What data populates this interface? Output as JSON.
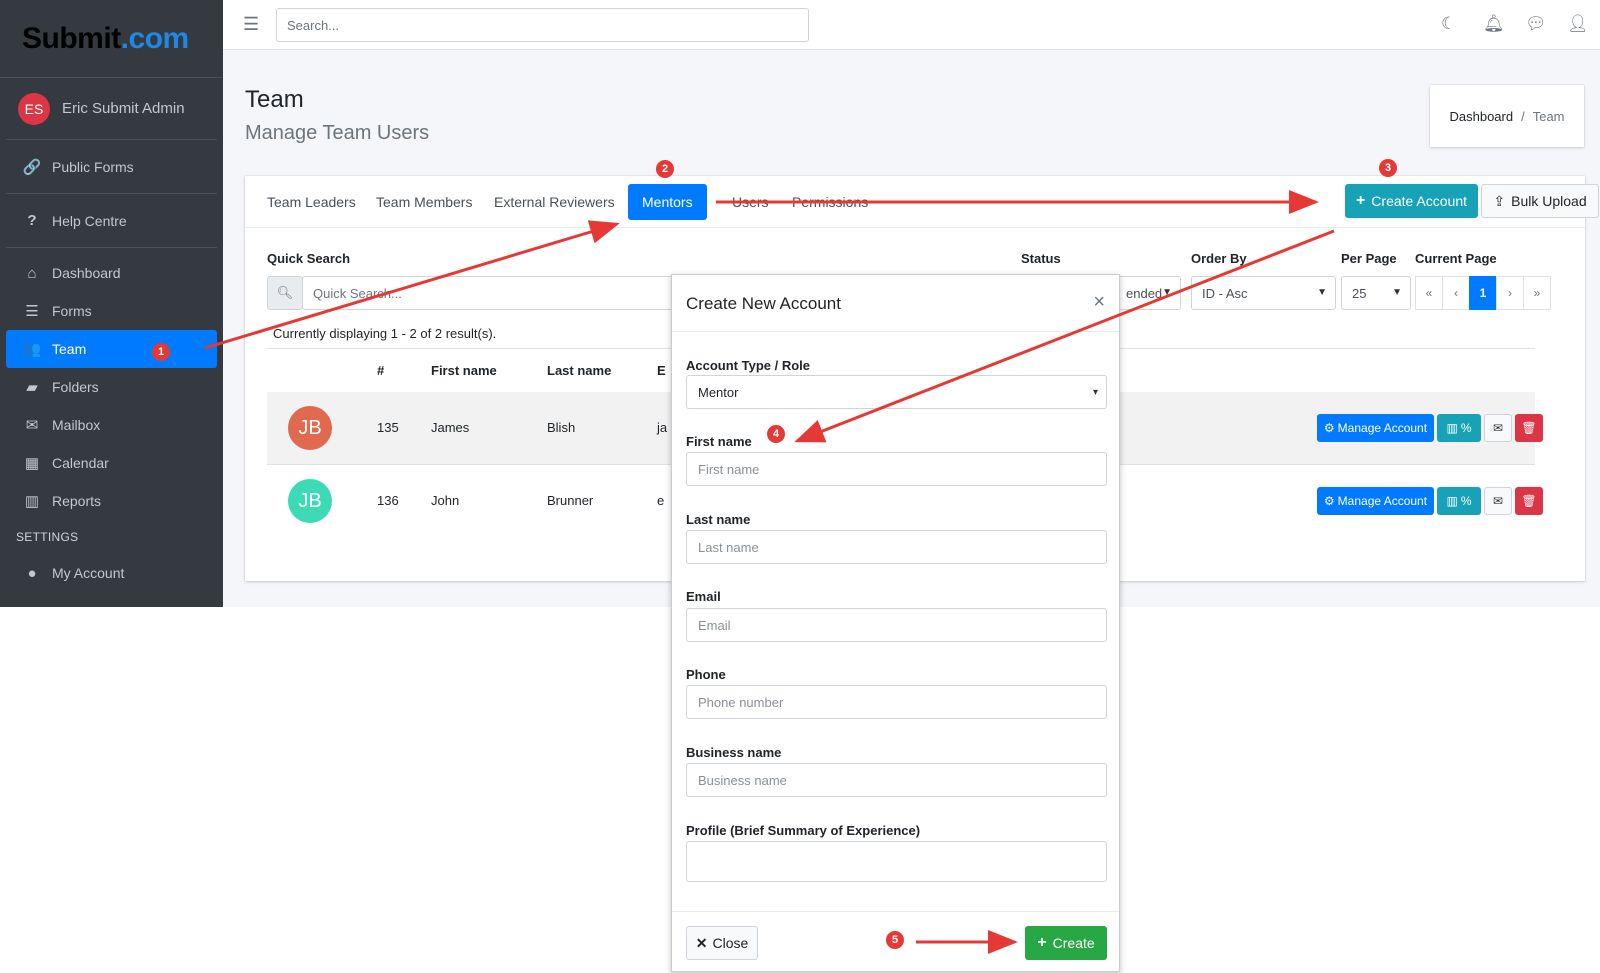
{
  "brand": {
    "part1": "Submit",
    "part2": ".com"
  },
  "user": {
    "initials": "ES",
    "name": "Eric Submit Admin"
  },
  "sidebar": {
    "public_forms": "Public Forms",
    "help_centre": "Help Centre",
    "items": [
      {
        "label": "Dashboard",
        "icon": "home-icon"
      },
      {
        "label": "Forms",
        "icon": "list-icon"
      },
      {
        "label": "Team",
        "icon": "users-icon"
      },
      {
        "label": "Folders",
        "icon": "folder-icon"
      },
      {
        "label": "Mailbox",
        "icon": "envelope-icon"
      },
      {
        "label": "Calendar",
        "icon": "calendar-icon"
      },
      {
        "label": "Reports",
        "icon": "chart-icon"
      }
    ],
    "settings_header": "SETTINGS",
    "my_account": "My Account"
  },
  "topbar": {
    "search_placeholder": "Search..."
  },
  "page": {
    "title": "Team",
    "subtitle": "Manage Team Users"
  },
  "breadcrumb": {
    "home": "Dashboard",
    "sep": "/",
    "current": "Team"
  },
  "tabs": [
    "Team Leaders",
    "Team Members",
    "External Reviewers",
    "Mentors",
    "Users",
    "Permissions"
  ],
  "actions": {
    "create_account": "Create Account",
    "bulk_upload": "Bulk Upload"
  },
  "filters": {
    "quick_search_label": "Quick Search",
    "quick_search_placeholder": "Quick Search...",
    "status_label": "Status",
    "status_value": "ended",
    "order_by_label": "Order By",
    "order_by_value": "ID - Asc",
    "per_page_label": "Per Page",
    "per_page_value": "25",
    "current_page_label": "Current Page",
    "pager": [
      "«",
      "‹",
      "1",
      "›",
      "»"
    ]
  },
  "table": {
    "count_text": "Currently displaying 1 - 2 of 2 result(s).",
    "headers": [
      "#",
      "First name",
      "Last name",
      "E"
    ],
    "rows": [
      {
        "initials": "JB",
        "id": "135",
        "first": "James",
        "last": "Blish",
        "email": "ja",
        "avatar_color": "#e0694f"
      },
      {
        "initials": "JB",
        "id": "136",
        "first": "John",
        "last": "Brunner",
        "email": "e",
        "avatar_color": "#3ddbb5"
      }
    ],
    "manage_label": "Manage Account",
    "stats_label": "%"
  },
  "modal": {
    "title": "Create New Account",
    "close_x": "×",
    "role_label": "Account Type / Role",
    "role_value": "Mentor",
    "first_label": "First name",
    "first_placeholder": "First name",
    "last_label": "Last name",
    "last_placeholder": "Last name",
    "email_label": "Email",
    "email_placeholder": "Email",
    "phone_label": "Phone",
    "phone_placeholder": "Phone number",
    "business_label": "Business name",
    "business_placeholder": "Business name",
    "profile_label": "Profile (Brief Summary of Experience)",
    "close_button": "Close",
    "create_button": "Create"
  },
  "annotations": [
    "1",
    "2",
    "3",
    "4",
    "5"
  ],
  "colors": {
    "sidebar": "#343a40",
    "primary": "#007bff",
    "teal": "#17a2b8",
    "success": "#28a745",
    "danger": "#dc3545",
    "arrow": "#e53935"
  }
}
